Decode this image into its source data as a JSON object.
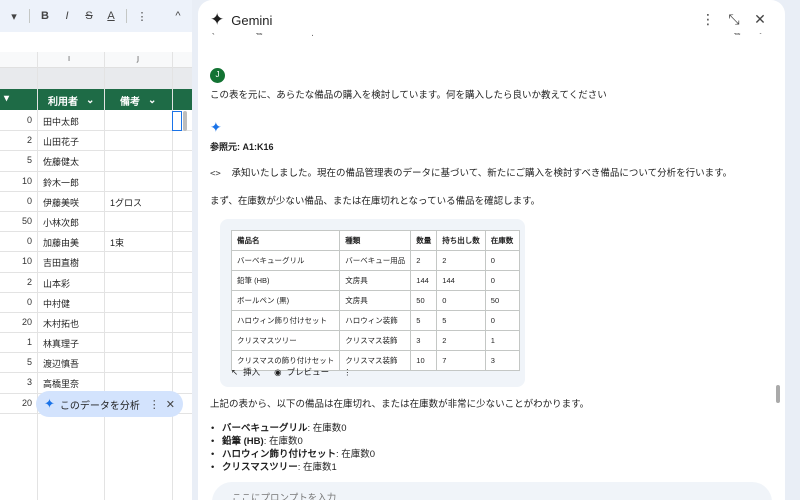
{
  "toolbar": {
    "bold": "B",
    "italic": "I",
    "strike": "S",
    "textcolor": "A",
    "more": "⋮",
    "collapse": "^"
  },
  "sheet": {
    "col_i": "I",
    "col_j": "J",
    "header_user": "利用者",
    "header_note": "備考",
    "rows": [
      {
        "n": "0",
        "user": "田中太郎",
        "note": ""
      },
      {
        "n": "2",
        "user": "山田花子",
        "note": ""
      },
      {
        "n": "5",
        "user": "佐藤健太",
        "note": ""
      },
      {
        "n": "10",
        "user": "鈴木一郎",
        "note": ""
      },
      {
        "n": "0",
        "user": "伊藤美咲",
        "note": "1グロス"
      },
      {
        "n": "50",
        "user": "小林次郎",
        "note": ""
      },
      {
        "n": "0",
        "user": "加藤由美",
        "note": "1束"
      },
      {
        "n": "10",
        "user": "吉田直樹",
        "note": ""
      },
      {
        "n": "2",
        "user": "山本彩",
        "note": ""
      },
      {
        "n": "0",
        "user": "中村健",
        "note": ""
      },
      {
        "n": "20",
        "user": "木村拓也",
        "note": ""
      },
      {
        "n": "1",
        "user": "林真理子",
        "note": ""
      },
      {
        "n": "5",
        "user": "渡辺慎吾",
        "note": ""
      },
      {
        "n": "3",
        "user": "高橋里奈",
        "note": ""
      },
      {
        "n": "20",
        "user": "",
        "note": ""
      }
    ],
    "analyze_label": "このデータを分析"
  },
  "panel": {
    "title": "Gemini",
    "user_prompt": "この表を元に、あらたな備品の購入を検討しています。何を購入したら良いか教えてください",
    "avatar_letter": "J",
    "source": "参照元: A1:K16",
    "code_badge": "<>",
    "intro": "承知いたしました。現在の備品管理表のデータに基づいて、新たにご購入を検討すべき備品について分析を行います。",
    "step1": "まず、在庫数が少ない備品、または在庫切れとなっている備品を確認します。",
    "table": {
      "headers": [
        "備品名",
        "種類",
        "数量",
        "持ち出し数",
        "在庫数"
      ],
      "rows": [
        [
          "バーベキューグリル",
          "バーベキュー用品",
          "2",
          "2",
          "0"
        ],
        [
          "鉛筆 (HB)",
          "文房具",
          "144",
          "144",
          "0"
        ],
        [
          "ボールペン (黒)",
          "文房具",
          "50",
          "0",
          "50"
        ],
        [
          "ハロウィン飾り付けセット",
          "ハロウィン装飾",
          "5",
          "5",
          "0"
        ],
        [
          "クリスマスツリー",
          "クリスマス装飾",
          "3",
          "2",
          "1"
        ],
        [
          "クリスマスの飾り付けセット",
          "クリスマス装飾",
          "10",
          "7",
          "3"
        ]
      ]
    },
    "insert_label": "挿入",
    "preview_label": "プレビュー",
    "conclusion": "上記の表から、以下の備品は在庫切れ、または在庫数が非常に少ないことがわかります。",
    "bullets": [
      {
        "name": "バーベキューグリル",
        "detail": ": 在庫数0"
      },
      {
        "name": "鉛筆 (HB)",
        "detail": ": 在庫数0"
      },
      {
        "name": "ハロウィン飾り付けセット",
        "detail": ": 在庫数0"
      },
      {
        "name": "クリスマスツリー",
        "detail": ": 在庫数1"
      }
    ],
    "input_placeholder": "ここにプロンプトを入力"
  },
  "colors": {
    "sheet_header_green": "#1e6b46",
    "gemini_blue": "#1a73e8",
    "avatar_green": "#137333"
  }
}
